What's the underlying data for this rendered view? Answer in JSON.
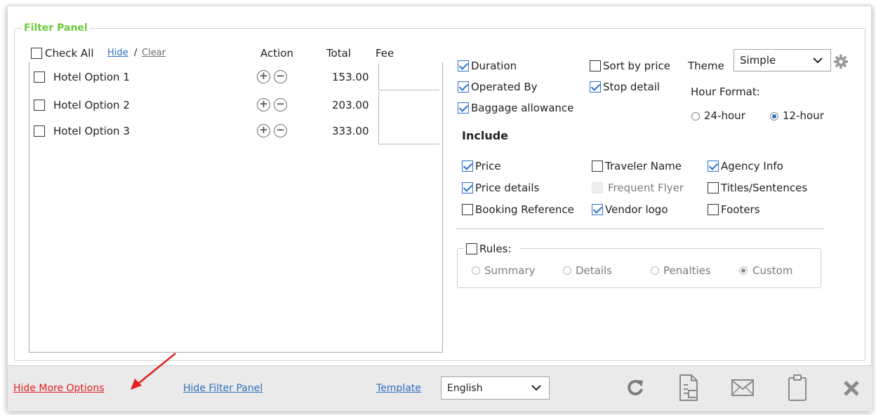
{
  "filter_panel": {
    "title": "Filter Panel",
    "check_all": "Check All",
    "hide_link": "Hide",
    "separator": "/",
    "clear_link": "Clear",
    "columns": {
      "action": "Action",
      "total": "Total",
      "fee": "Fee"
    },
    "rows": [
      {
        "name": "Hotel Option 1",
        "total": "153.00",
        "checked": false
      },
      {
        "name": "Hotel Option 2",
        "total": "203.00",
        "checked": false
      },
      {
        "name": "Hotel Option 3",
        "total": "333.00",
        "checked": false
      }
    ]
  },
  "options": {
    "duration": "Duration",
    "operated_by": "Operated By",
    "baggage_allowance": "Baggage allowance",
    "sort_by_price": "Sort by price",
    "stop_detail": "Stop detail",
    "theme_label": "Theme",
    "theme_value": "Simple",
    "hour_format_label": "Hour Format:",
    "hour_24": "24-hour",
    "hour_12": "12-hour"
  },
  "include": {
    "heading": "Include",
    "price": "Price",
    "price_details": "Price details",
    "booking_reference": "Booking Reference",
    "traveler_name": "Traveler Name",
    "frequent_flyer": "Frequent Flyer",
    "vendor_logo": "Vendor logo",
    "agency_info": "Agency Info",
    "titles_sentences": "Titles/Sentences",
    "footers": "Footers"
  },
  "rules": {
    "label": "Rules:",
    "summary": "Summary",
    "details": "Details",
    "penalties": "Penalties",
    "custom": "Custom"
  },
  "bottom_bar": {
    "hide_more_options": "Hide More Options",
    "hide_filter_panel": "Hide Filter Panel",
    "template": "Template",
    "language": "English"
  },
  "colors": {
    "filter_title": "#6ccb3a",
    "link": "#2f6fbf",
    "warning_link": "#e02020",
    "check_accent": "#2b6fd1"
  },
  "icons": {
    "refresh": "refresh-icon",
    "export": "export-document-icon",
    "email": "envelope-icon",
    "clipboard": "clipboard-icon",
    "close": "close-icon",
    "settings": "gear-icon"
  }
}
